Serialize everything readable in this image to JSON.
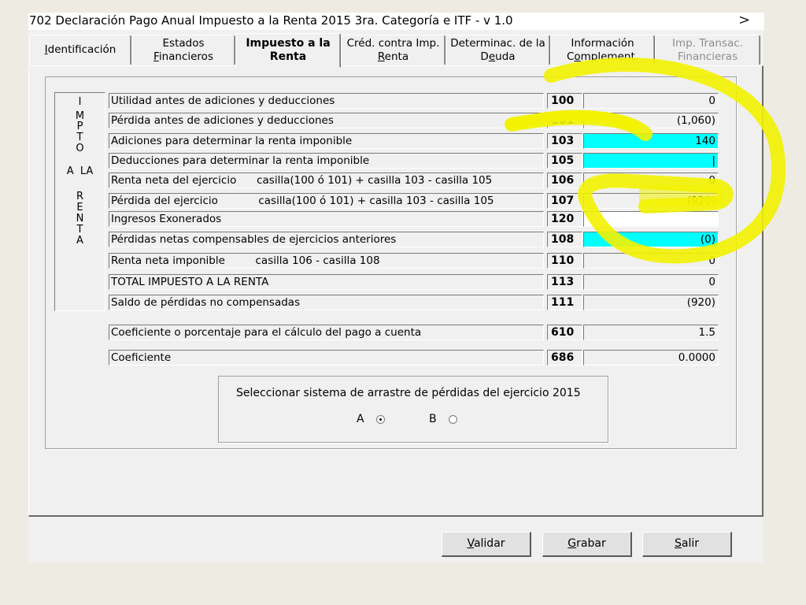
{
  "window": {
    "title": "702 Declaración Pago Anual Impuesto a la Renta 2015 3ra. Categoría e ITF - v 1.0",
    "overflow_arrow": ">"
  },
  "tabs": [
    {
      "line1": "Identificación",
      "line2": "",
      "state": "normal"
    },
    {
      "line1": "Estados",
      "line2": "Financieros",
      "state": "normal"
    },
    {
      "line1": "Impuesto a la",
      "line2": "Renta",
      "state": "active"
    },
    {
      "line1": "Créd. contra Imp.",
      "line2": "Renta",
      "state": "normal"
    },
    {
      "line1": "Determinac. de la",
      "line2": "Deuda",
      "state": "normal"
    },
    {
      "line1": "Información",
      "line2": "Complement.",
      "state": "normal"
    },
    {
      "line1": "Imp. Transac.",
      "line2": "Financieras",
      "state": "disabled"
    }
  ],
  "side_label": [
    "I",
    "M",
    "P",
    "T",
    "O",
    "A  LA",
    "R",
    "E",
    "N",
    "T",
    "A"
  ],
  "rows": [
    {
      "label": "Utilidad antes de adiciones y deducciones",
      "code": "100",
      "value": "0",
      "style": "normal"
    },
    {
      "label": "Pérdida antes de adiciones y deducciones",
      "code": "101",
      "value": "(1,060)",
      "style": "normal"
    },
    {
      "label": "Adiciones para determinar la renta imponible",
      "code": "103",
      "value": "140",
      "style": "cyan"
    },
    {
      "label": "Deducciones para determinar la renta imponible",
      "code": "105",
      "value": "|",
      "style": "cyan"
    },
    {
      "label": "Renta neta del ejercicio      casilla(100 ó 101) + casilla 103 - casilla 105",
      "code": "106",
      "value": "0",
      "style": "normal"
    },
    {
      "label": "Pérdida del ejercicio            casilla(100 ó 101) + casilla 103 - casilla 105",
      "code": "107",
      "value": "(920)",
      "style": "normal"
    },
    {
      "label": "Ingresos Exonerados",
      "code": "120",
      "value": "",
      "style": "white"
    },
    {
      "label": "Pérdidas netas compensables de ejercicios anteriores",
      "code": "108",
      "value": "(0)",
      "style": "cyan"
    },
    {
      "label": "Renta neta imponible         casilla 106 - casilla 108",
      "code": "110",
      "value": "0",
      "style": "normal"
    },
    {
      "label": "TOTAL IMPUESTO A LA RENTA",
      "code": "113",
      "value": "0",
      "style": "normal"
    },
    {
      "label": "Saldo de pérdidas no compensadas",
      "code": "111",
      "value": "(920)",
      "style": "normal"
    },
    {
      "label": "Coeficiente o porcentaje para el cálculo del pago a cuenta",
      "code": "610",
      "value": "1.5",
      "style": "normal"
    },
    {
      "label": "Coeficiente",
      "code": "686",
      "value": "0.0000",
      "style": "normal"
    }
  ],
  "loss_system": {
    "prompt": "Seleccionar sistema de arrastre de pérdidas del ejercicio 2015",
    "options": [
      {
        "label": "A",
        "checked": true
      },
      {
        "label": "B",
        "checked": false
      }
    ]
  },
  "buttons": [
    {
      "label": "Validar"
    },
    {
      "label": "Grabar"
    },
    {
      "label": "Salir"
    }
  ],
  "colors": {
    "editable_field": "#00FFFF",
    "highlight_marker": "#F2F200"
  }
}
